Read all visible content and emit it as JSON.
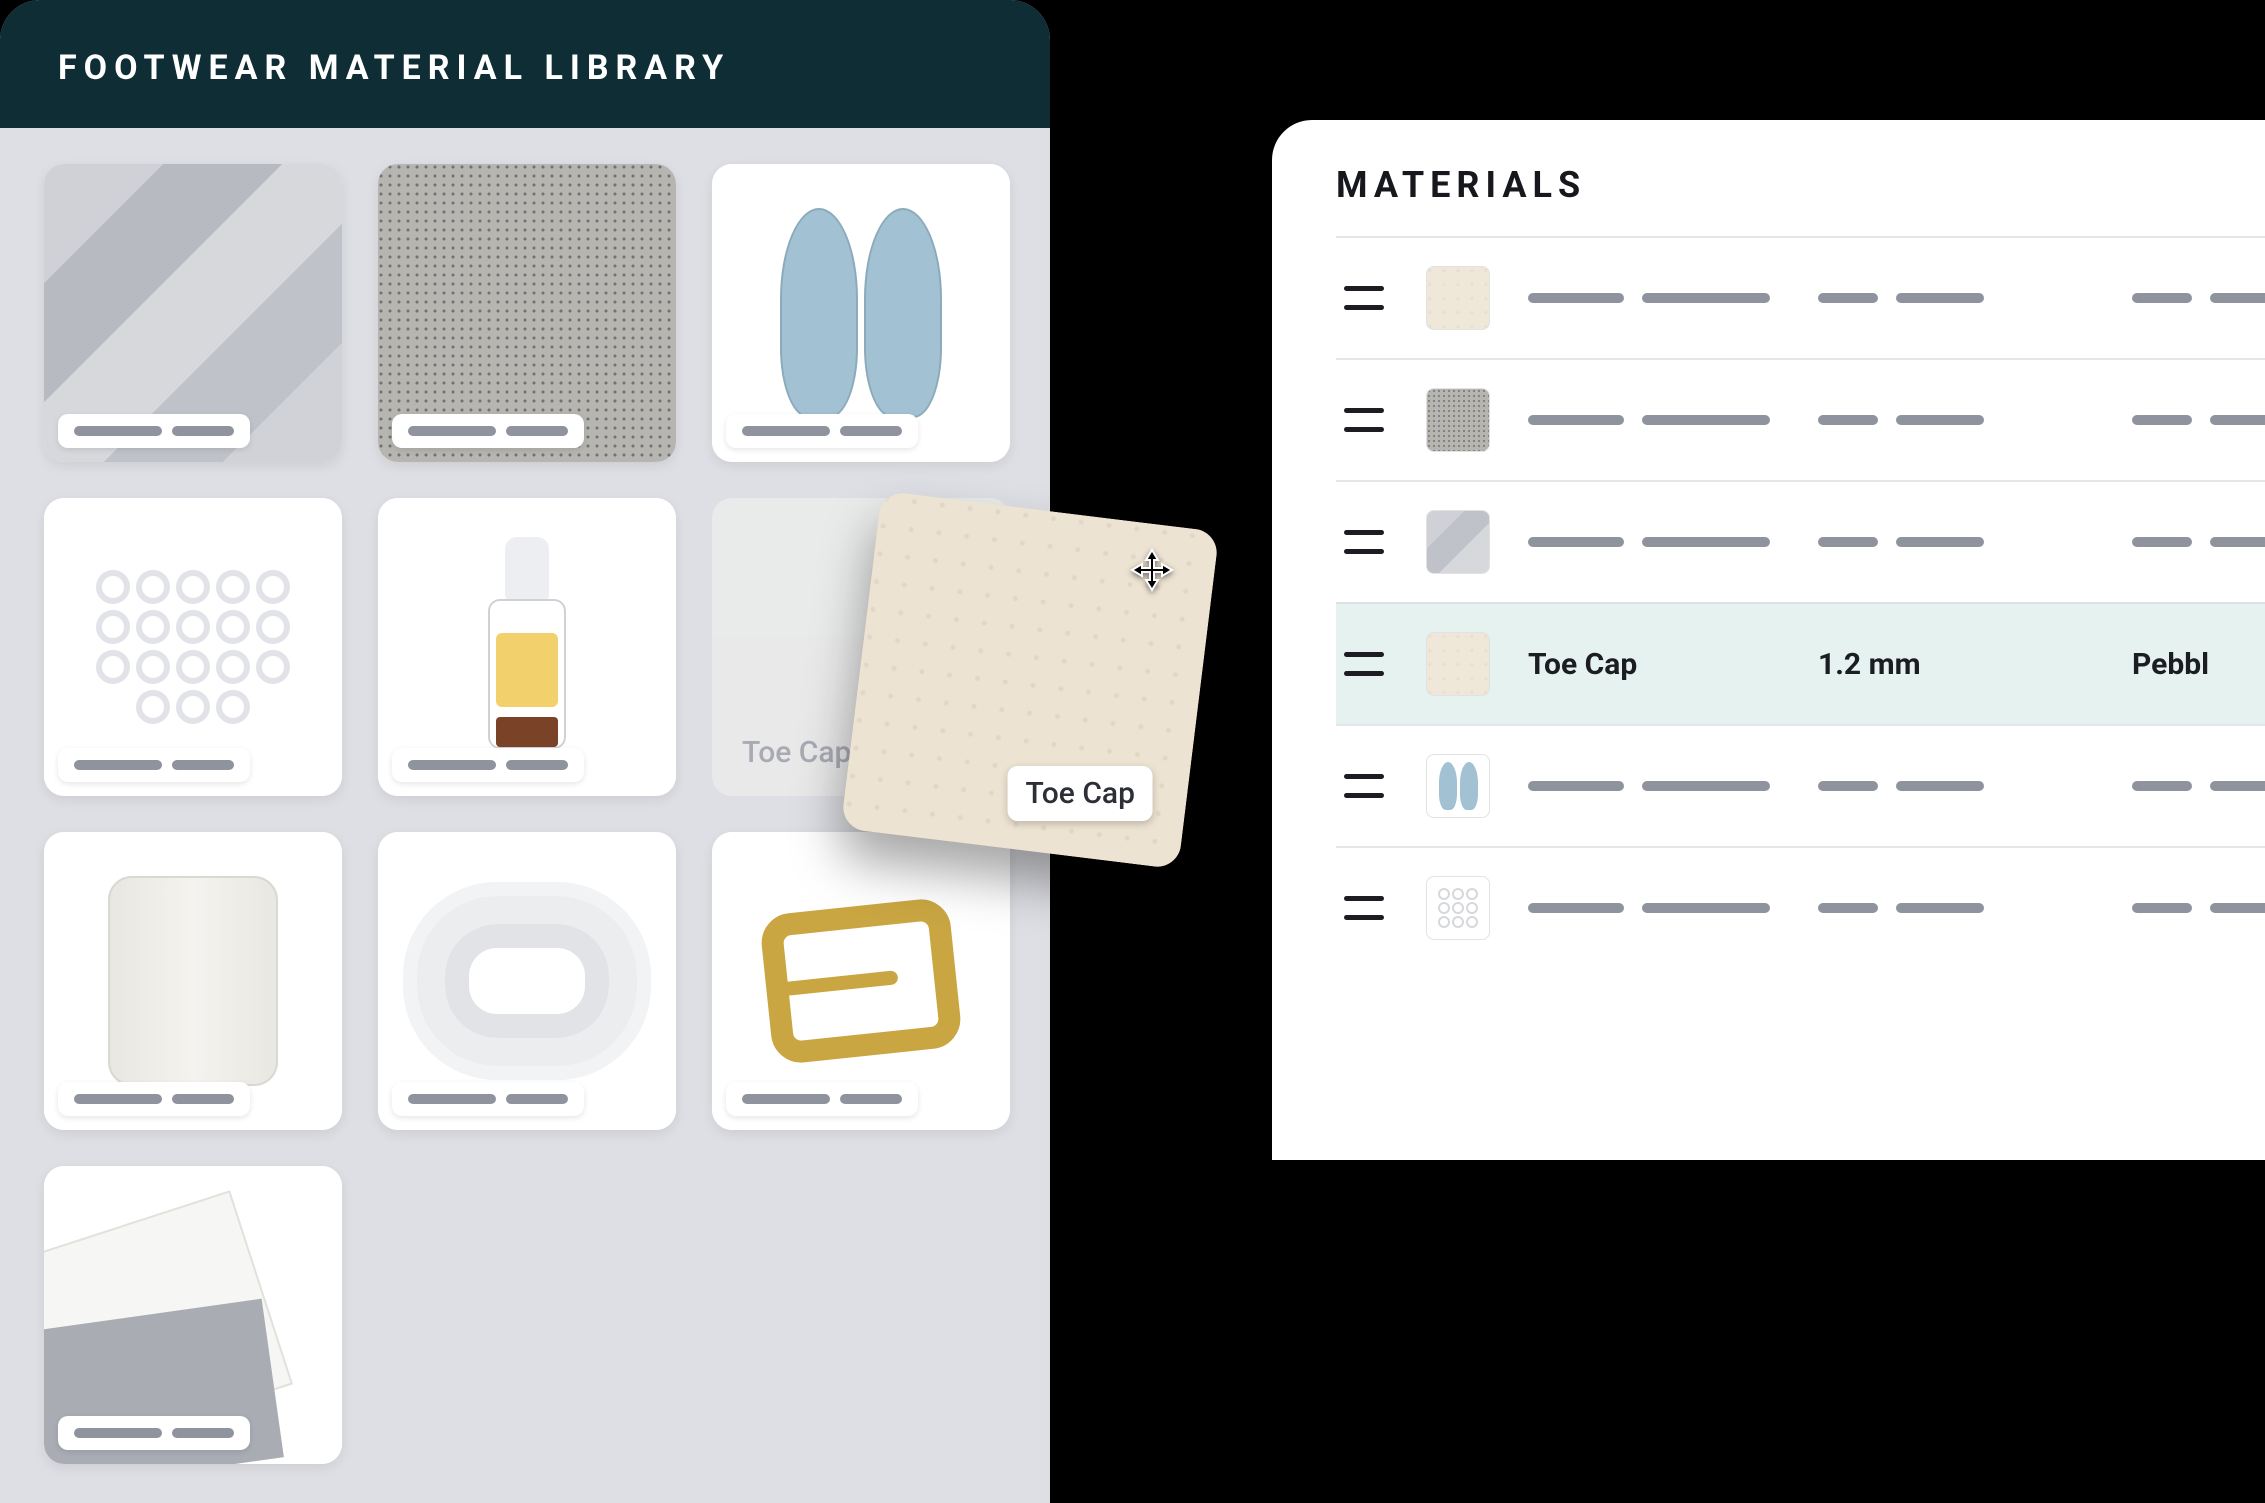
{
  "library": {
    "title": "FOOTWEAR MATERIAL LIBRARY",
    "cards": [
      {
        "id": "fabric",
        "swatch": "sw-fabric"
      },
      {
        "id": "mesh",
        "swatch": "sw-mesh"
      },
      {
        "id": "insoles",
        "swatch": "sw-insoles"
      },
      {
        "id": "eyelets",
        "swatch": "sw-eyelets"
      },
      {
        "id": "glue",
        "swatch": "sw-glue"
      },
      {
        "id": "leather-ghost",
        "swatch": "sw-leather-ghost",
        "ghost": true,
        "ghost_label": "Toe Cap"
      },
      {
        "id": "thread",
        "swatch": "sw-thread"
      },
      {
        "id": "laces",
        "swatch": "sw-laces"
      },
      {
        "id": "buckle",
        "swatch": "sw-buckle"
      },
      {
        "id": "foam",
        "swatch": "sw-foam"
      }
    ]
  },
  "drag": {
    "label": "Toe Cap"
  },
  "detail": {
    "title": "MATERIALS",
    "rows": [
      {
        "thumb": "leather"
      },
      {
        "thumb": "mesh"
      },
      {
        "thumb": "fabric"
      },
      {
        "thumb": "leather",
        "highlight": true,
        "name": "Toe Cap",
        "spec": "1.2 mm",
        "finish": "Pebbl"
      },
      {
        "thumb": "insoles"
      },
      {
        "thumb": "eyelets"
      }
    ]
  }
}
